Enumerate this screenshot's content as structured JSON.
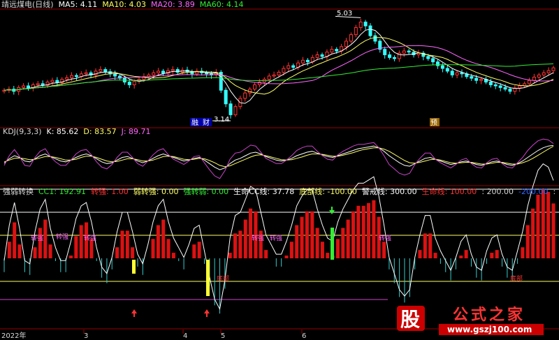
{
  "main_legend": [
    {
      "text": "靖远煤电(日线)",
      "color": "#d8d8d8"
    },
    {
      "text": "MA5: 4.11",
      "color": "#ffffff"
    },
    {
      "text": "MA10: 4.03",
      "color": "#ffff66"
    },
    {
      "text": "MA20: 3.89",
      "color": "#ff66ff"
    },
    {
      "text": "MA60: 4.14",
      "color": "#33ee33"
    }
  ],
  "kdj_legend": [
    {
      "text": "KDJ(9,3,3)",
      "color": "#d8d8d8"
    },
    {
      "text": "K: 85.62",
      "color": "#ffffff"
    },
    {
      "text": "D: 83.57",
      "color": "#ffff66"
    },
    {
      "text": "J: 89.71",
      "color": "#ff66ff"
    }
  ],
  "cc_legend": [
    {
      "text": "强弱转换",
      "color": "#d8d8d8"
    },
    {
      "text": "CC1: 192.91",
      "color": "#33ee33"
    },
    {
      "text": "转强: 1.00",
      "color": "#ff3333"
    },
    {
      "text": "弱转强: 0.00",
      "color": "#ffff66"
    },
    {
      "text": "强转弱: 0.00",
      "color": "#33ee33"
    },
    {
      "text": "生命CC线: 37.78",
      "color": "#ffffff"
    },
    {
      "text": "底部线: -100.00",
      "color": "#ffff66"
    },
    {
      "text": "警戒线: 300.00",
      "color": "#ffffff"
    },
    {
      "text": "生命线: 100.00",
      "color": "#ff3333"
    },
    {
      "text": ": 200.00",
      "color": "#d8d8d8"
    },
    {
      "text": "-200.00",
      "color": "#3366ff"
    },
    {
      "text": ": 100.00",
      "color": "#d8d8d8"
    }
  ],
  "annotations": {
    "high_price": "5.03",
    "low_price": "3.14",
    "tag_a": "融",
    "tag_b": "财",
    "tag_c": "预",
    "strong_labels": [
      "转强",
      "转强",
      "转强",
      "转强",
      "转强",
      "转强"
    ],
    "bottom_label": "底部",
    "watermark_gu": "股",
    "watermark_name": "公式之家",
    "watermark_url": "www.gszj100.com"
  },
  "x_axis_labels": [
    "2022年",
    "3",
    "4",
    "5",
    "6"
  ],
  "colors": {
    "up": "#ff3333",
    "down": "#33ffff",
    "background": "#000000",
    "grid": "#800000",
    "ma5": "#ffffff",
    "ma10": "#ffff66",
    "ma20": "#ff66ff",
    "ma60": "#33ee33"
  },
  "chart_data": [
    {
      "type": "candlestick",
      "close": [
        3.7,
        3.72,
        3.68,
        3.75,
        3.78,
        3.74,
        3.8,
        3.82,
        3.79,
        3.85,
        3.88,
        3.84,
        3.9,
        3.93,
        3.97,
        3.95,
        4.0,
        4.02,
        3.98,
        4.05,
        4.08,
        4.04,
        4.0,
        3.96,
        3.92,
        3.85,
        3.8,
        3.86,
        3.9,
        3.95,
        3.98,
        4.02,
        4.05,
        4.01,
        4.06,
        4.08,
        4.03,
        4.07,
        4.04,
        4.0,
        4.05,
        4.02,
        4.0,
        3.98,
        4.03,
        3.7,
        3.45,
        3.25,
        3.4,
        3.55,
        3.65,
        3.72,
        3.8,
        3.85,
        3.9,
        3.96,
        3.98,
        4.03,
        4.1,
        4.15,
        4.12,
        4.2,
        4.25,
        4.22,
        4.3,
        4.35,
        4.32,
        4.4,
        4.45,
        4.42,
        4.5,
        4.6,
        4.72,
        4.85,
        4.95,
        4.88,
        4.7,
        4.6,
        4.45,
        4.35,
        4.3,
        4.28,
        4.38,
        4.42,
        4.4,
        4.35,
        4.38,
        4.32,
        4.28,
        4.22,
        4.15,
        4.1,
        4.05,
        3.98,
        4.02,
        4.0,
        3.95,
        3.92,
        3.88,
        3.9,
        3.85,
        3.8,
        3.78,
        3.75,
        3.72,
        3.68,
        3.74,
        3.78,
        3.82,
        3.88,
        3.94,
        3.98,
        4.02,
        4.06,
        4.11
      ],
      "ma_values": {
        "MA5": 4.11,
        "MA10": 4.03,
        "MA20": 3.89,
        "MA60": 4.14
      },
      "high_marker": 5.03,
      "low_marker": 3.14
    },
    {
      "type": "line",
      "name": "KDJ(9,3,3)",
      "series": [
        {
          "name": "K",
          "values": [
            45,
            55,
            62,
            58,
            50,
            48,
            55,
            62,
            66,
            60,
            55,
            50,
            48,
            52,
            58,
            63,
            66,
            62,
            55,
            48,
            44,
            46,
            52,
            58,
            60,
            56,
            50,
            46,
            50,
            56,
            62,
            66,
            62,
            58,
            54,
            50,
            52,
            56,
            58,
            52,
            44,
            36,
            30,
            34,
            44,
            52,
            56,
            62,
            68,
            70,
            66,
            60,
            56,
            52,
            50,
            52,
            56,
            62,
            66,
            70,
            72,
            68,
            64,
            60,
            58,
            62,
            66,
            70,
            74,
            78,
            80,
            82,
            84,
            80,
            72,
            62,
            54,
            46,
            40,
            38,
            44,
            50,
            56,
            58,
            54,
            50,
            46,
            42,
            44,
            48,
            50,
            46,
            42,
            40,
            44,
            48,
            50,
            46,
            42,
            40,
            44,
            50,
            58,
            66,
            74,
            80,
            84,
            85.62
          ]
        },
        {
          "name": "D",
          "values": [
            48,
            52,
            56,
            57,
            55,
            53,
            54,
            57,
            60,
            60,
            58,
            55,
            52,
            52,
            54,
            58,
            61,
            61,
            58,
            54,
            50,
            48,
            49,
            52,
            55,
            55,
            53,
            50,
            50,
            52,
            56,
            60,
            61,
            60,
            57,
            54,
            53,
            54,
            56,
            55,
            51,
            46,
            40,
            37,
            39,
            44,
            49,
            54,
            59,
            63,
            64,
            62,
            59,
            56,
            53,
            52,
            53,
            56,
            59,
            63,
            66,
            66,
            65,
            63,
            61,
            61,
            63,
            66,
            69,
            73,
            76,
            78,
            80,
            80,
            77,
            72,
            65,
            58,
            51,
            46,
            45,
            47,
            50,
            53,
            54,
            52,
            49,
            46,
            45,
            46,
            47,
            47,
            45,
            43,
            43,
            45,
            47,
            47,
            45,
            43,
            43,
            46,
            50,
            56,
            63,
            70,
            77,
            83.57
          ]
        },
        {
          "name": "J",
          "values": [
            40,
            62,
            76,
            60,
            40,
            38,
            58,
            72,
            78,
            60,
            48,
            40,
            40,
            52,
            66,
            74,
            76,
            64,
            48,
            36,
            32,
            42,
            58,
            70,
            70,
            58,
            44,
            38,
            50,
            64,
            74,
            78,
            64,
            54,
            48,
            42,
            50,
            60,
            62,
            46,
            30,
            16,
            10,
            28,
            54,
            68,
            70,
            78,
            86,
            84,
            70,
            56,
            50,
            44,
            44,
            52,
            62,
            74,
            80,
            84,
            84,
            72,
            62,
            54,
            52,
            64,
            72,
            78,
            84,
            88,
            88,
            90,
            92,
            80,
            62,
            42,
            32,
            22,
            18,
            22,
            42,
            56,
            68,
            68,
            54,
            46,
            40,
            34,
            42,
            52,
            56,
            44,
            36,
            34,
            46,
            54,
            56,
            44,
            36,
            34,
            46,
            58,
            74,
            86,
            96,
            100,
            98,
            89.71
          ]
        }
      ]
    },
    {
      "type": "bar",
      "name": "强弱转换",
      "lines": {
        "警戒线": 300,
        "": 200,
        "生命线": 100,
        "底部线": -100,
        "-200": -200
      },
      "cc1_value": 192.91,
      "life_cc_value": 37.78
    }
  ]
}
